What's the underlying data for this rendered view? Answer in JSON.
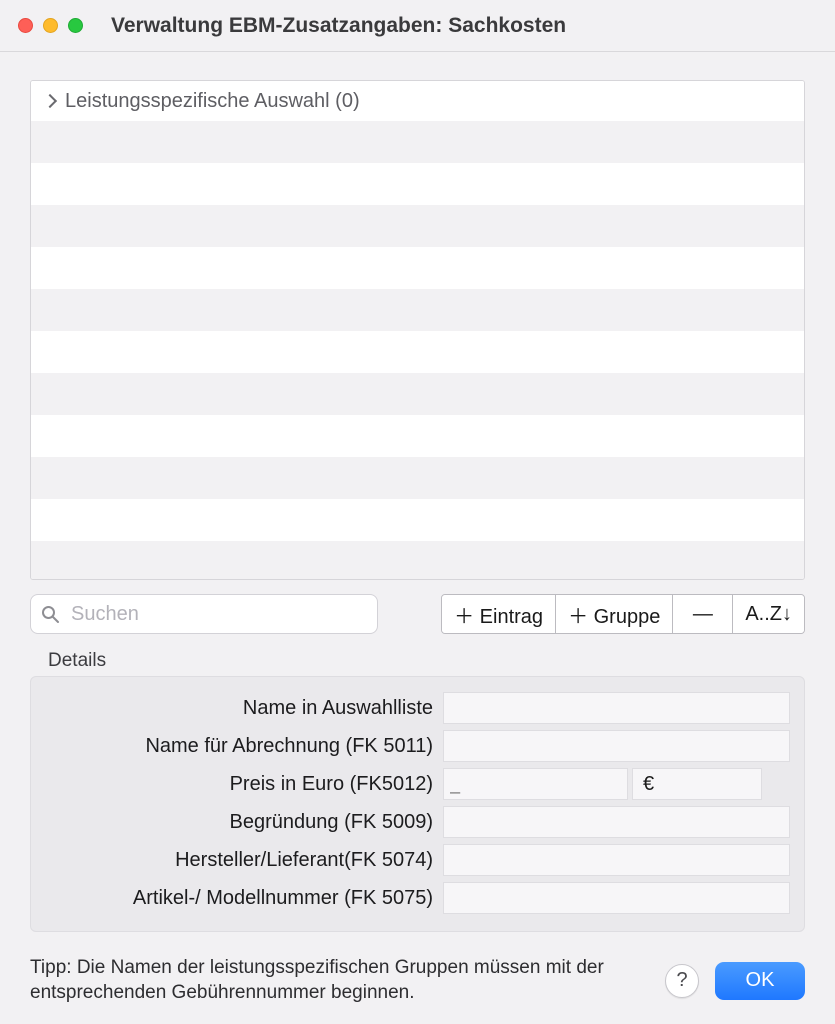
{
  "window": {
    "title": "Verwaltung EBM-Zusatzangaben: Sachkosten"
  },
  "list": {
    "header": "Leistungsspezifische Auswahl (0)"
  },
  "search": {
    "placeholder": "Suchen"
  },
  "toolbar": {
    "add_entry": "＋ Eintrag",
    "add_group": "＋ Gruppe",
    "remove": "—",
    "sort": "A..Z↓"
  },
  "details": {
    "title": "Details",
    "fields": {
      "name_list": {
        "label": "Name in Auswahlliste",
        "value": ""
      },
      "name_billing": {
        "label": "Name für Abrechnung (FK 5011)",
        "value": ""
      },
      "price": {
        "label": "Preis in Euro (FK5012)",
        "value": "",
        "placeholder": "_",
        "suffix": "€"
      },
      "reason": {
        "label": "Begründung (FK 5009)",
        "value": ""
      },
      "supplier": {
        "label": "Hersteller/Lieferant(FK 5074)",
        "value": ""
      },
      "model": {
        "label": "Artikel-/ Modellnummer (FK 5075)",
        "value": ""
      }
    }
  },
  "footer": {
    "tip": "Tipp: Die Namen der leistungsspezifischen Gruppen müssen mit der entsprechenden Gebührennummer beginnen.",
    "help": "?",
    "ok": "OK"
  }
}
